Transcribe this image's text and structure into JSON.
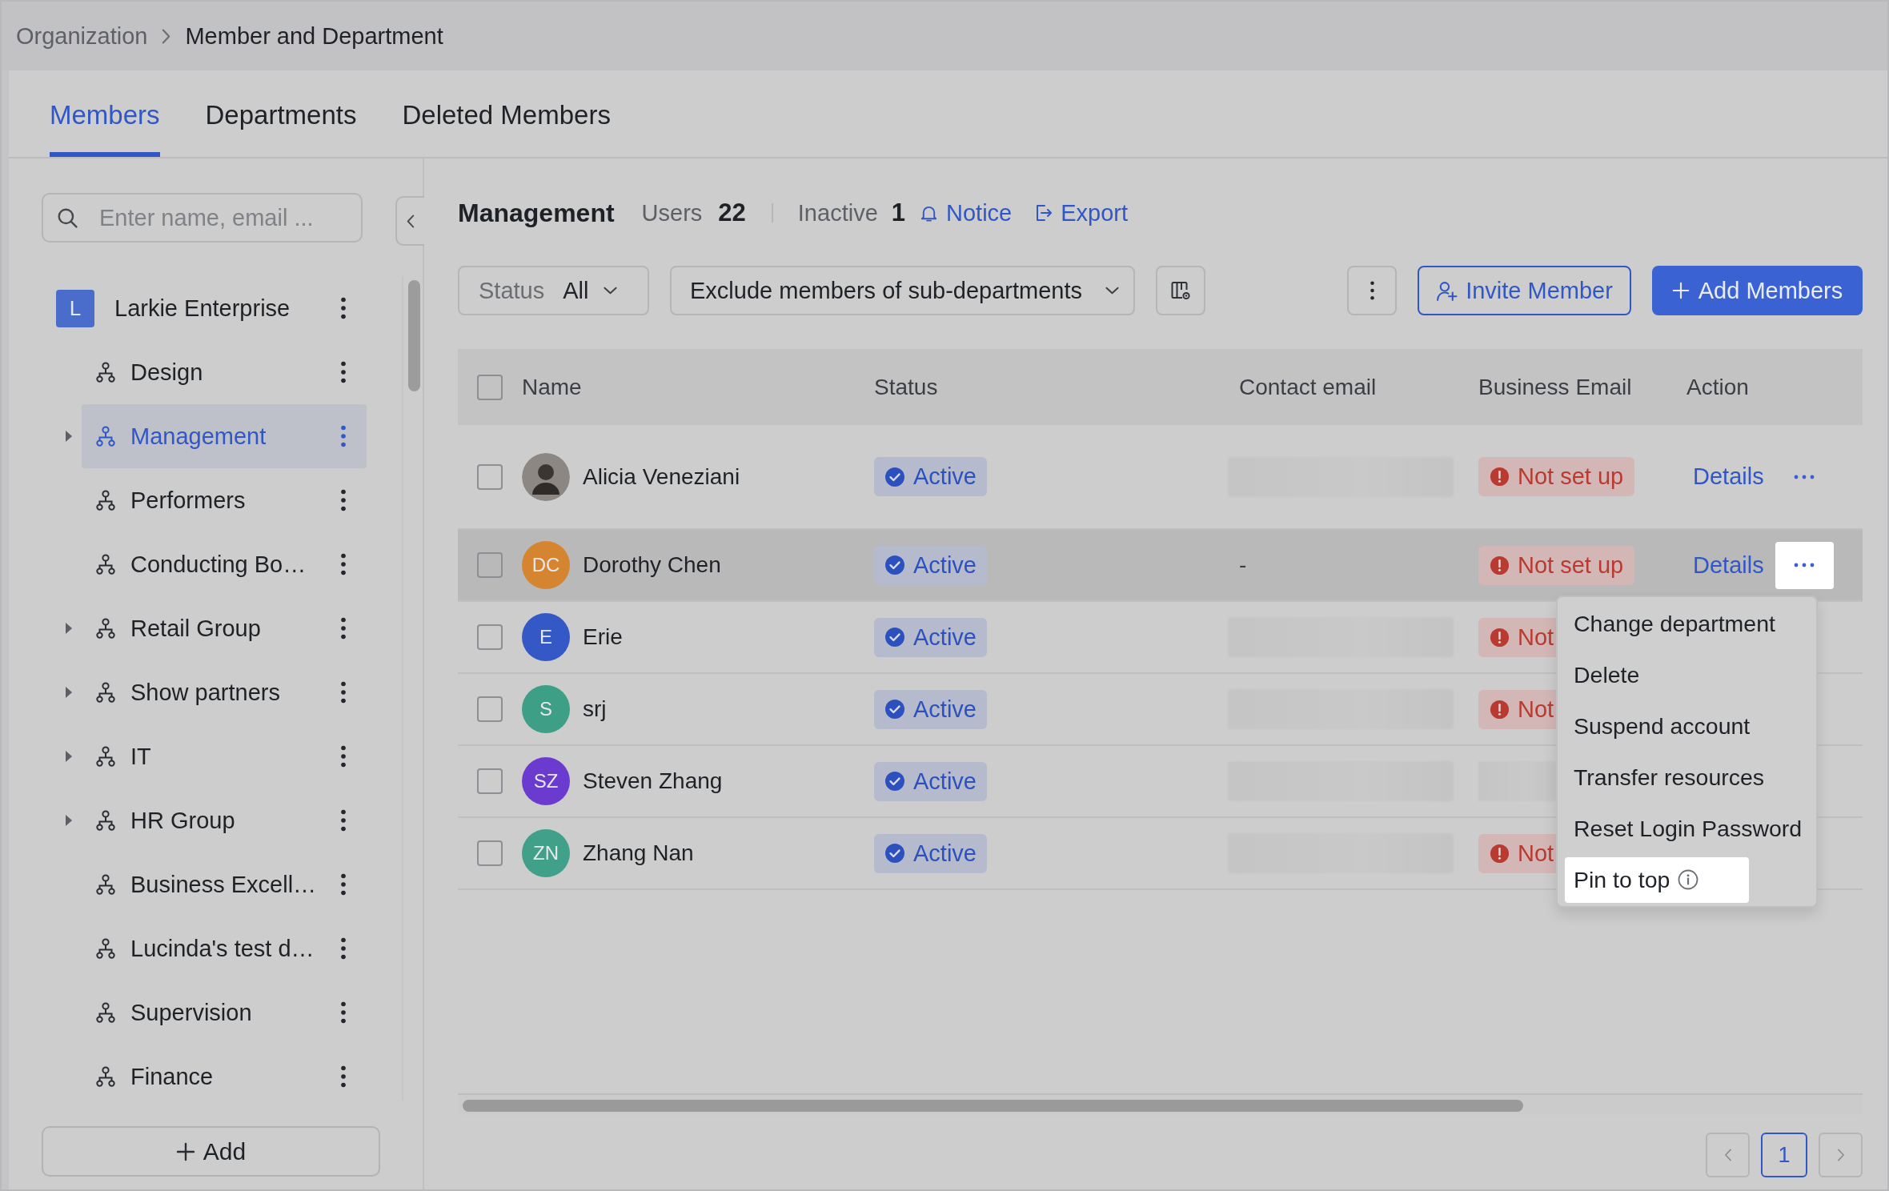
{
  "breadcrumb": {
    "items": [
      {
        "label": "Organization",
        "current": false
      },
      {
        "label": "Member and Department",
        "current": true
      }
    ]
  },
  "tabs": [
    {
      "label": "Members",
      "selected": true
    },
    {
      "label": "Departments",
      "selected": false
    },
    {
      "label": "Deleted Members",
      "selected": false
    }
  ],
  "sidebar": {
    "search": {
      "placeholder": "Enter name, email ..."
    },
    "organization": {
      "logo": "L",
      "label": "Larkie Enterprise"
    },
    "departments": [
      {
        "label": "Design",
        "has_children": false,
        "selected": false
      },
      {
        "label": "Management",
        "has_children": true,
        "selected": true
      },
      {
        "label": "Performers",
        "has_children": false,
        "selected": false
      },
      {
        "label": "Conducting Bo…",
        "has_children": false,
        "selected": false
      },
      {
        "label": "Retail Group",
        "has_children": true,
        "selected": false
      },
      {
        "label": "Show partners",
        "has_children": true,
        "selected": false
      },
      {
        "label": "IT",
        "has_children": true,
        "selected": false
      },
      {
        "label": "HR Group",
        "has_children": true,
        "selected": false
      },
      {
        "label": "Business Excell…",
        "has_children": false,
        "selected": false
      },
      {
        "label": "Lucinda's test d…",
        "has_children": false,
        "selected": false
      },
      {
        "label": "Supervision",
        "has_children": false,
        "selected": false
      },
      {
        "label": "Finance",
        "has_children": false,
        "selected": false
      }
    ],
    "add_button": "Add"
  },
  "department": {
    "title": "Management",
    "users_label": "Users",
    "users_count": "22",
    "inactive_label": "Inactive",
    "inactive_count": "1",
    "notice_link": "Notice",
    "export_link": "Export"
  },
  "toolbar": {
    "status_filter": {
      "label": "Status",
      "value": "All"
    },
    "scope_filter": {
      "value": "Exclude members of sub-departments"
    },
    "invite_button": "Invite Member",
    "add_button": "Add Members"
  },
  "table": {
    "columns": [
      "Name",
      "Status",
      "Contact email",
      "Business Email",
      "Action"
    ],
    "all_checked": false,
    "rows": [
      {
        "checked": false,
        "highlighted": false,
        "avatar": {
          "kind": "photo"
        },
        "name": "Alicia Veneziani",
        "status": "Active",
        "contact_email": {
          "kind": "redacted"
        },
        "business_email": {
          "kind": "badge",
          "text": "Not set up"
        },
        "actions": {
          "details": "Details",
          "menu_open": false
        }
      },
      {
        "checked": false,
        "highlighted": true,
        "avatar": {
          "kind": "initials",
          "initials": "DC",
          "color": "#d5852f"
        },
        "name": "Dorothy Chen",
        "status": "Active",
        "contact_email": {
          "kind": "text",
          "text": "-"
        },
        "business_email": {
          "kind": "badge",
          "text": "Not set up"
        },
        "actions": {
          "details": "Details",
          "menu_open": true
        }
      },
      {
        "checked": false,
        "highlighted": false,
        "avatar": {
          "kind": "initials",
          "initials": "E",
          "color": "#3458c6"
        },
        "name": "Erie",
        "status": "Active",
        "contact_email": {
          "kind": "redacted"
        },
        "business_email": {
          "kind": "badge",
          "text": "Not"
        }
      },
      {
        "checked": false,
        "highlighted": false,
        "avatar": {
          "kind": "initials",
          "initials": "S",
          "color": "#3d9f86"
        },
        "name": "srj",
        "status": "Active",
        "contact_email": {
          "kind": "redacted"
        },
        "business_email": {
          "kind": "badge",
          "text": "Not"
        }
      },
      {
        "checked": false,
        "highlighted": false,
        "avatar": {
          "kind": "initials",
          "initials": "SZ",
          "color": "#6b3bcf"
        },
        "name": "Steven Zhang",
        "status": "Active",
        "contact_email": {
          "kind": "redacted"
        },
        "business_email": {
          "kind": "redacted"
        }
      },
      {
        "checked": false,
        "highlighted": false,
        "avatar": {
          "kind": "initials",
          "initials": "ZN",
          "color": "#41a089"
        },
        "name": "Zhang Nan",
        "status": "Active",
        "contact_email": {
          "kind": "redacted"
        },
        "business_email": {
          "kind": "badge",
          "text": "Not"
        }
      }
    ]
  },
  "row_menu": {
    "items": [
      {
        "label": "Change department",
        "selected": false,
        "info": false
      },
      {
        "label": "Delete",
        "selected": false,
        "info": false
      },
      {
        "label": "Suspend account",
        "selected": false,
        "info": false
      },
      {
        "label": "Transfer resources",
        "selected": false,
        "info": false
      },
      {
        "label": "Reset Login Password",
        "selected": false,
        "info": false
      },
      {
        "label": "Pin to top",
        "selected": true,
        "info": true
      }
    ]
  },
  "pagination": {
    "pages": [
      {
        "label": "1",
        "selected": true
      }
    ]
  }
}
